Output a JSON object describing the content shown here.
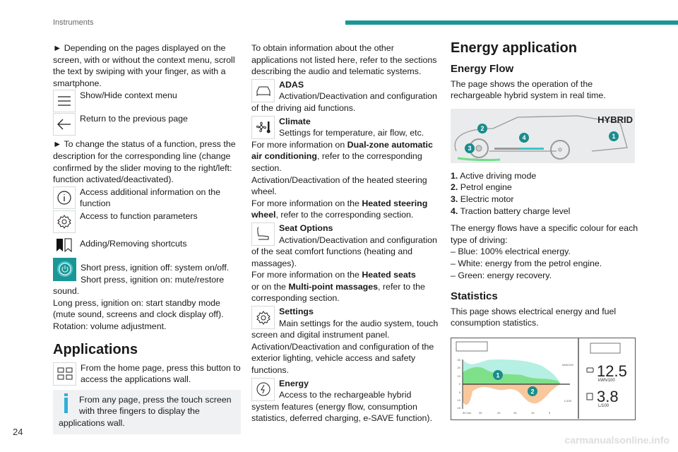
{
  "header": {
    "section": "Instruments"
  },
  "footer": {
    "page_number": "24",
    "watermark": "carmanualsonline.info"
  },
  "col1": {
    "intro": "► Depending on the pages displayed on the screen, with or without the context menu, scroll the text by swiping with your finger, as with a smartphone.",
    "icons1": [
      {
        "icon": "menu-icon",
        "text": "Show/Hide context menu"
      },
      {
        "icon": "back-arrow-icon",
        "text": "Return to the previous page"
      }
    ],
    "change": "► To change the status of a function, press the description for the corresponding line (change confirmed by the slider moving to the right/left: function activated/deactivated).",
    "icons2": [
      {
        "icon": "info-icon",
        "text": "Access additional information on the function"
      },
      {
        "icon": "gear-icon",
        "text": "Access to function parameters"
      },
      {
        "icon": "bookmark-icon",
        "text": "Adding/Removing shortcuts"
      }
    ],
    "power": {
      "icon": "power-icon",
      "color": "#1a9696",
      "text1": "Short press, ignition off: system on/off.",
      "text2": "Short press, ignition on: mute/restore sound.",
      "text3": "Long press, ignition on: start standby mode (mute sound, screens and clock display off).",
      "text4": "Rotation: volume adjustment."
    },
    "apps_title": "Applications",
    "apps_text": "From the home page, press this button to access the applications wall.",
    "note": "From any page, press the touch screen with three fingers to display the applications wall."
  },
  "col2": {
    "intro": "To obtain information about the other applications not listed here, refer to the sections describing the audio and telematic systems.",
    "adas": {
      "title": "ADAS",
      "text": "Activation/Deactivation and configuration of the driving aid functions."
    },
    "climate": {
      "title": "Climate",
      "text": "Settings for temperature, air flow, etc.",
      "more1_pre": "For more information on ",
      "more1_bold": "Dual-zone automatic air conditioning",
      "more1_post": ", refer to the corresponding section.",
      "heated": "Activation/Deactivation of the heated steering wheel.",
      "more2_pre": "For more information on the ",
      "more2_bold": "Heated steering wheel",
      "more2_post": ", refer to the corresponding section."
    },
    "seat": {
      "title": "Seat Options",
      "text": "Activation/Deactivation and configuration of the seat comfort functions (heating and massages).",
      "more_pre": "For more information on the ",
      "more_bold1": "Heated seats",
      "more_mid": " or on the ",
      "more_bold2": "Multi-point massages",
      "more_post": ", refer to the corresponding section."
    },
    "settings": {
      "title": "Settings",
      "text": "Main settings for the audio system, touch screen and digital instrument panel. Activation/Deactivation and configuration of the exterior lighting, vehicle access and safety functions."
    },
    "energy": {
      "title": "Energy",
      "text": "Access to the rechargeable hybrid system features (energy flow, consumption statistics, deferred charging, e-SAVE function)."
    }
  },
  "col3": {
    "title": "Energy application",
    "flow_title": "Energy Flow",
    "flow_text": "The page shows the operation of the rechargeable hybrid system in real time.",
    "hybrid_label": "HYBRID",
    "callouts": [
      "1",
      "2",
      "3",
      "4"
    ],
    "legend": [
      {
        "n": "1.",
        "t": "Active driving mode"
      },
      {
        "n": "2.",
        "t": "Petrol engine"
      },
      {
        "n": "3.",
        "t": "Electric motor"
      },
      {
        "n": "4.",
        "t": "Traction battery charge level"
      }
    ],
    "colours_intro": "The energy flows have a specific colour for each type of driving:",
    "colours": [
      "– Blue: 100% electrical energy.",
      "– White: energy from the petrol engine.",
      "– Green: energy recovery."
    ],
    "stats_title": "Statistics",
    "stats_text": "This page shows electrical energy and fuel consumption statistics.",
    "stats_image": {
      "y_ticks": [
        "30",
        "20",
        "10",
        "0",
        "5",
        "10",
        "15"
      ],
      "x_ticks": [
        "30 min",
        "25",
        "20",
        "15",
        "10",
        "5"
      ],
      "unit_top": "kWh/100",
      "unit_bottom": "L/100",
      "elec_value": "12.5",
      "elec_unit": "kWh/100",
      "fuel_value": "3.8",
      "fuel_unit": "L/100"
    }
  }
}
